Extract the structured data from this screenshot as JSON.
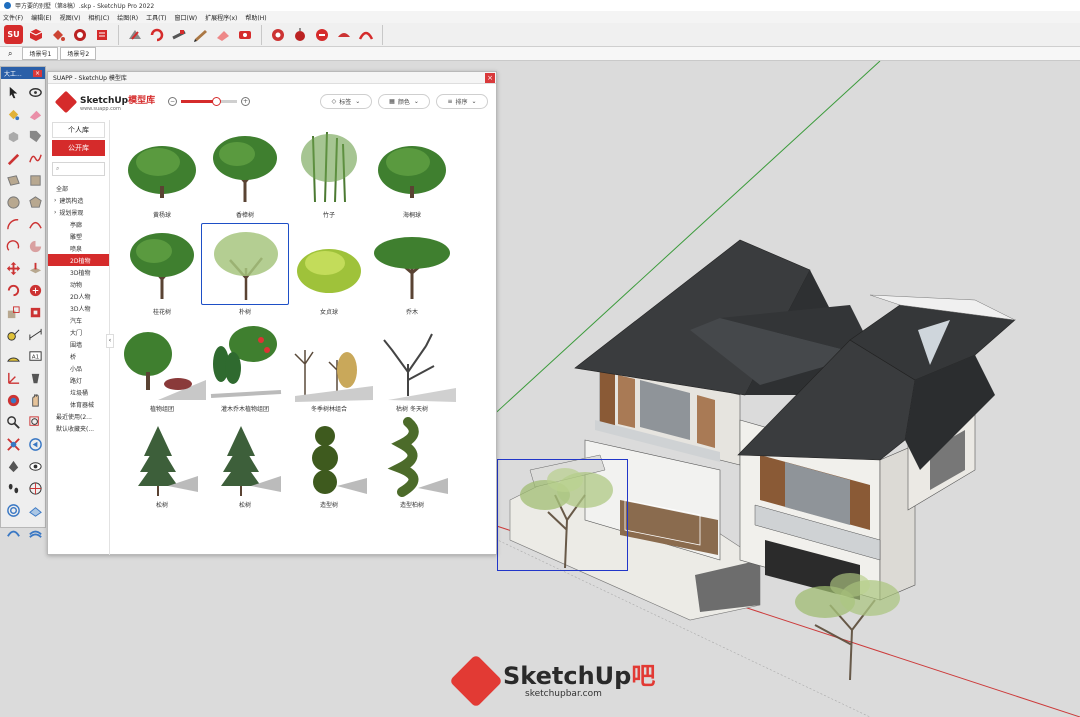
{
  "window": {
    "title": "甲方要的别墅（第8稿）.skp - SketchUp Pro 2022"
  },
  "menu": [
    "文件(F)",
    "编辑(E)",
    "视图(V)",
    "相机(C)",
    "绘图(R)",
    "工具(T)",
    "窗口(W)",
    "扩展程序(x)",
    "帮助(H)"
  ],
  "scenes": [
    "场景号1",
    "场景号2"
  ],
  "left_toolbar": {
    "title": "大工..."
  },
  "panel": {
    "title": "SUAPP - SketchUp 模型库",
    "close": "×",
    "logo": {
      "brand": "SketchUp",
      "brand_suffix": "模型库",
      "url": "www.suapp.com"
    },
    "zoom_level": 0.62,
    "filters": [
      {
        "label": "标签",
        "icon": "tag-icon"
      },
      {
        "label": "颜色",
        "icon": "palette-icon"
      },
      {
        "label": "排序",
        "icon": "sort-icon"
      }
    ],
    "tabs": [
      {
        "label": "个人库",
        "active": false
      },
      {
        "label": "公开库",
        "active": true
      }
    ],
    "categories": [
      {
        "label": "全部",
        "level": "top",
        "active": false
      },
      {
        "label": "建筑构造",
        "level": "group",
        "active": false
      },
      {
        "label": "规划景观",
        "level": "group",
        "active": false
      },
      {
        "label": "亭廊",
        "level": "sub",
        "active": false
      },
      {
        "label": "雕塑",
        "level": "sub",
        "active": false
      },
      {
        "label": "喷泉",
        "level": "sub",
        "active": false
      },
      {
        "label": "2D植物",
        "level": "sub",
        "active": true
      },
      {
        "label": "3D植物",
        "level": "sub",
        "active": false
      },
      {
        "label": "动物",
        "level": "sub",
        "active": false
      },
      {
        "label": "2D人物",
        "level": "sub",
        "active": false
      },
      {
        "label": "3D人物",
        "level": "sub",
        "active": false
      },
      {
        "label": "汽车",
        "level": "sub",
        "active": false
      },
      {
        "label": "大门",
        "level": "sub",
        "active": false
      },
      {
        "label": "围墙",
        "level": "sub",
        "active": false
      },
      {
        "label": "桥",
        "level": "sub",
        "active": false
      },
      {
        "label": "小品",
        "level": "sub",
        "active": false
      },
      {
        "label": "路灯",
        "level": "sub",
        "active": false
      },
      {
        "label": "垃圾桶",
        "level": "sub",
        "active": false
      },
      {
        "label": "体育器械",
        "level": "sub",
        "active": false
      },
      {
        "label": "最近使用(2...",
        "level": "top",
        "active": false
      },
      {
        "label": "默认收藏夹(...",
        "level": "top",
        "active": false
      }
    ],
    "items": [
      {
        "name": "黄杨球",
        "selected": false
      },
      {
        "name": "香樟树",
        "selected": false
      },
      {
        "name": "竹子",
        "selected": false
      },
      {
        "name": "海桐球",
        "selected": false
      },
      {
        "name": "桂花树",
        "selected": false
      },
      {
        "name": "朴树",
        "selected": true
      },
      {
        "name": "女贞球",
        "selected": false
      },
      {
        "name": "乔木",
        "selected": false
      },
      {
        "name": "植物组团",
        "selected": false
      },
      {
        "name": "灌木乔木植物组团",
        "selected": false
      },
      {
        "name": "冬季树林组合",
        "selected": false
      },
      {
        "name": "枯树 冬天树",
        "selected": false
      },
      {
        "name": "松树",
        "selected": false
      },
      {
        "name": "松树",
        "selected": false
      },
      {
        "name": "造型树",
        "selected": false
      },
      {
        "name": "造型柏树",
        "selected": false
      }
    ]
  },
  "watermark": {
    "brand": "SketchUp",
    "brand_suffix": "吧",
    "url": "sketchupbar.com"
  },
  "colors": {
    "accent": "#d52b2b",
    "selection": "#2136c9",
    "roof": "#3a3c3e",
    "wood": "#8a5a36"
  }
}
